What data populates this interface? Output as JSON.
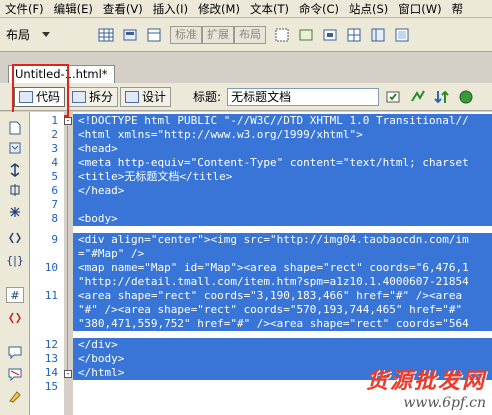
{
  "menubar": {
    "items": [
      "文件(F)",
      "编辑(E)",
      "查看(V)",
      "插入(I)",
      "修改(M)",
      "文本(T)",
      "命令(C)",
      "站点(S)",
      "窗口(W)",
      "帮"
    ]
  },
  "toolbar": {
    "layout_label": "布局",
    "view_buttons": [
      "标准",
      "扩展",
      "布局"
    ]
  },
  "document": {
    "tab_title": "Untitled-1.html*",
    "mode_buttons": [
      "代码",
      "拆分",
      "设计"
    ],
    "title_label": "标题:",
    "title_value": "无标题文档"
  },
  "editor": {
    "line_numbers": [
      "1",
      "2",
      "3",
      "4",
      "5",
      "6",
      "7",
      "8",
      "9",
      "10",
      "11",
      "12",
      "13",
      "14",
      "15"
    ],
    "code_lines": [
      "<!DOCTYPE html PUBLIC \"-//W3C//DTD XHTML 1.0 Transitional//",
      "<html xmlns=\"http://www.w3.org/1999/xhtml\">",
      "<head>",
      "<meta http-equiv=\"Content-Type\" content=\"text/html; charset",
      "<title>无标题文档</title>",
      "</head>",
      "",
      "<body>",
      "<div align=\"center\"><img src=\"http://img04.taobaocdn.com/im",
      "=\"#Map\" />",
      "<map name=\"Map\" id=\"Map\"><area shape=\"rect\" coords=\"6,476,1",
      "\"http://detail.tmall.com/item.htm?spm=a1z10.1.4000607-21854",
      "<area shape=\"rect\" coords=\"3,190,183,466\" href=\"#\" /><area",
      "\"#\" /><area shape=\"rect\" coords=\"570,193,744,465\" href=\"#\"",
      "\"380,471,559,752\" href=\"#\" /><area shape=\"rect\" coords=\"564",
      "</div>",
      "</body>",
      "</html>"
    ]
  },
  "watermark": {
    "brand": "货源批发网",
    "site": "www.6pf.cn"
  }
}
